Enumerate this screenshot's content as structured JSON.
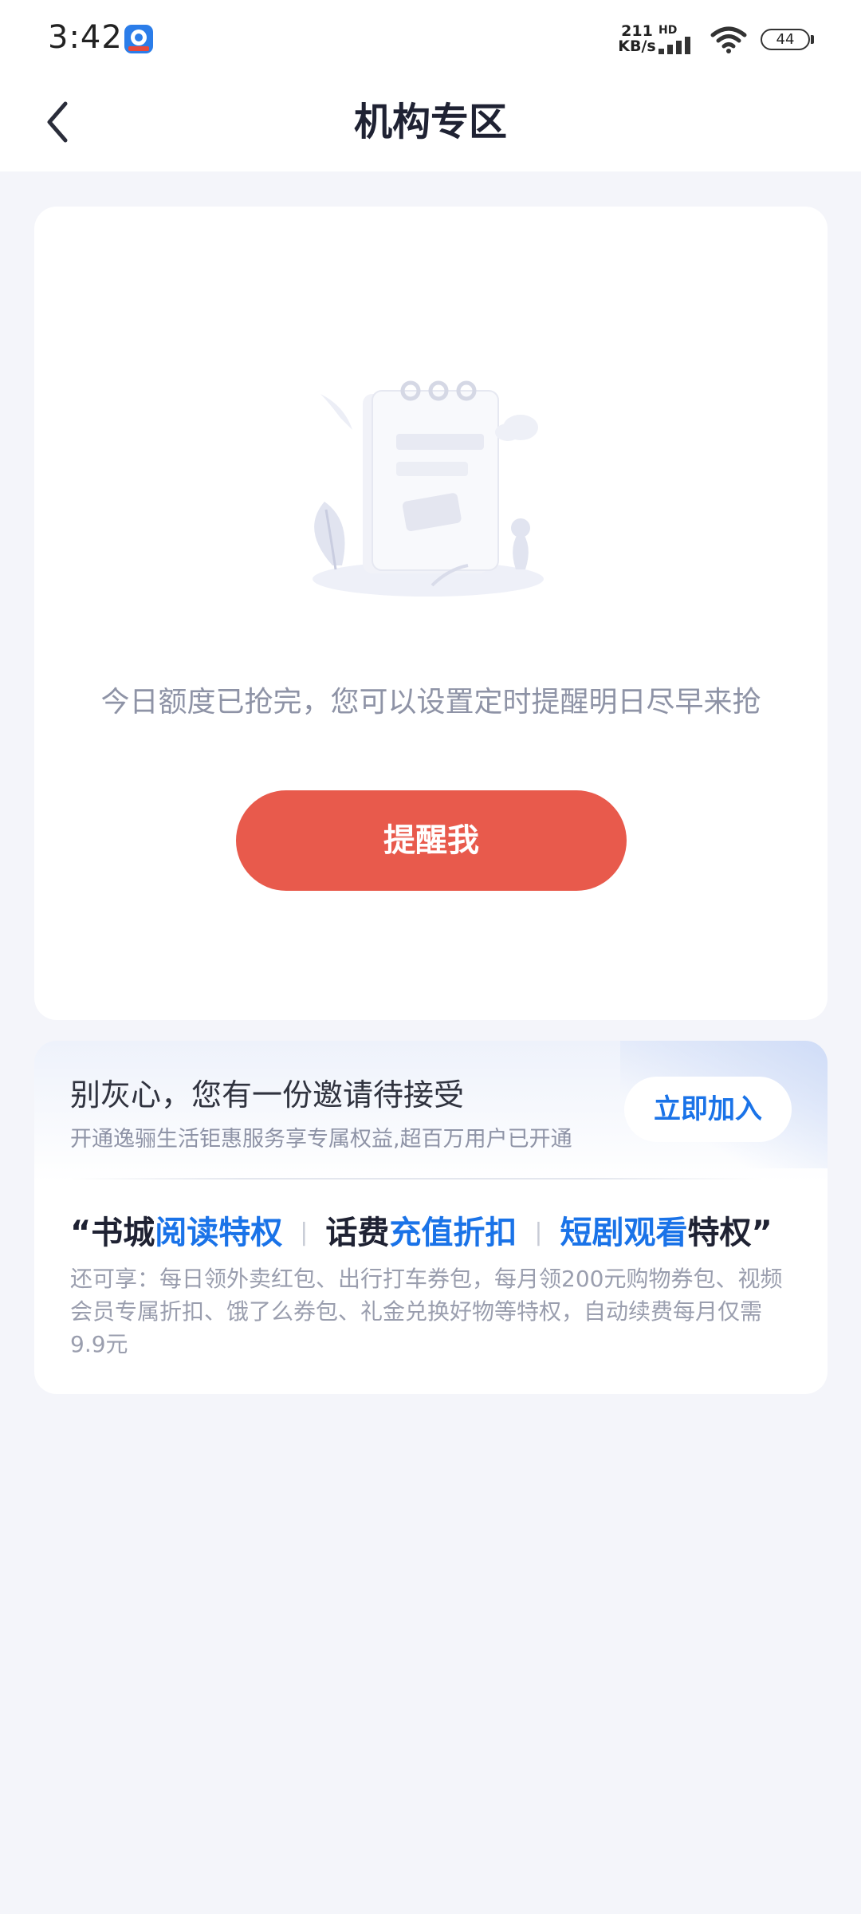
{
  "status_bar": {
    "time": "3:42",
    "net_speed_value": "211",
    "net_speed_unit": "KB/s",
    "hd_label": "HD",
    "battery": "44"
  },
  "nav": {
    "title": "机构专区"
  },
  "main_card": {
    "message": "今日额度已抢完，您可以设置定时提醒明日尽早来抢",
    "remind_button": "提醒我"
  },
  "invite_card": {
    "title": "别灰心，您有一份邀请待接受",
    "subtitle": "开通逸骊生活钜惠服务享专属权益,超百万用户已开通",
    "join_button": "立即加入",
    "perks": {
      "open_quote": "“",
      "p1_a": "书城",
      "p1_b": "阅读特权",
      "sep1": "|",
      "p2_a": "话费",
      "p2_b": "充值折扣",
      "sep2": "|",
      "p3_a": "短剧观看",
      "p3_b": "特权",
      "close_quote": "”"
    },
    "more_text": "还可享：每日领外卖红包、出行打车券包，每月领200元购物券包、视频会员专属折扣、饿了么券包、礼金兑换好物等特权，自动续费每月仅需9.9元"
  },
  "colors": {
    "accent_red": "#e85a4c",
    "accent_blue": "#1a73e8",
    "background": "#f4f5fa"
  },
  "icons": [
    "app-logo-icon",
    "signal-icon",
    "wifi-icon",
    "battery-icon",
    "back-arrow-icon",
    "empty-notepad-illustration"
  ]
}
